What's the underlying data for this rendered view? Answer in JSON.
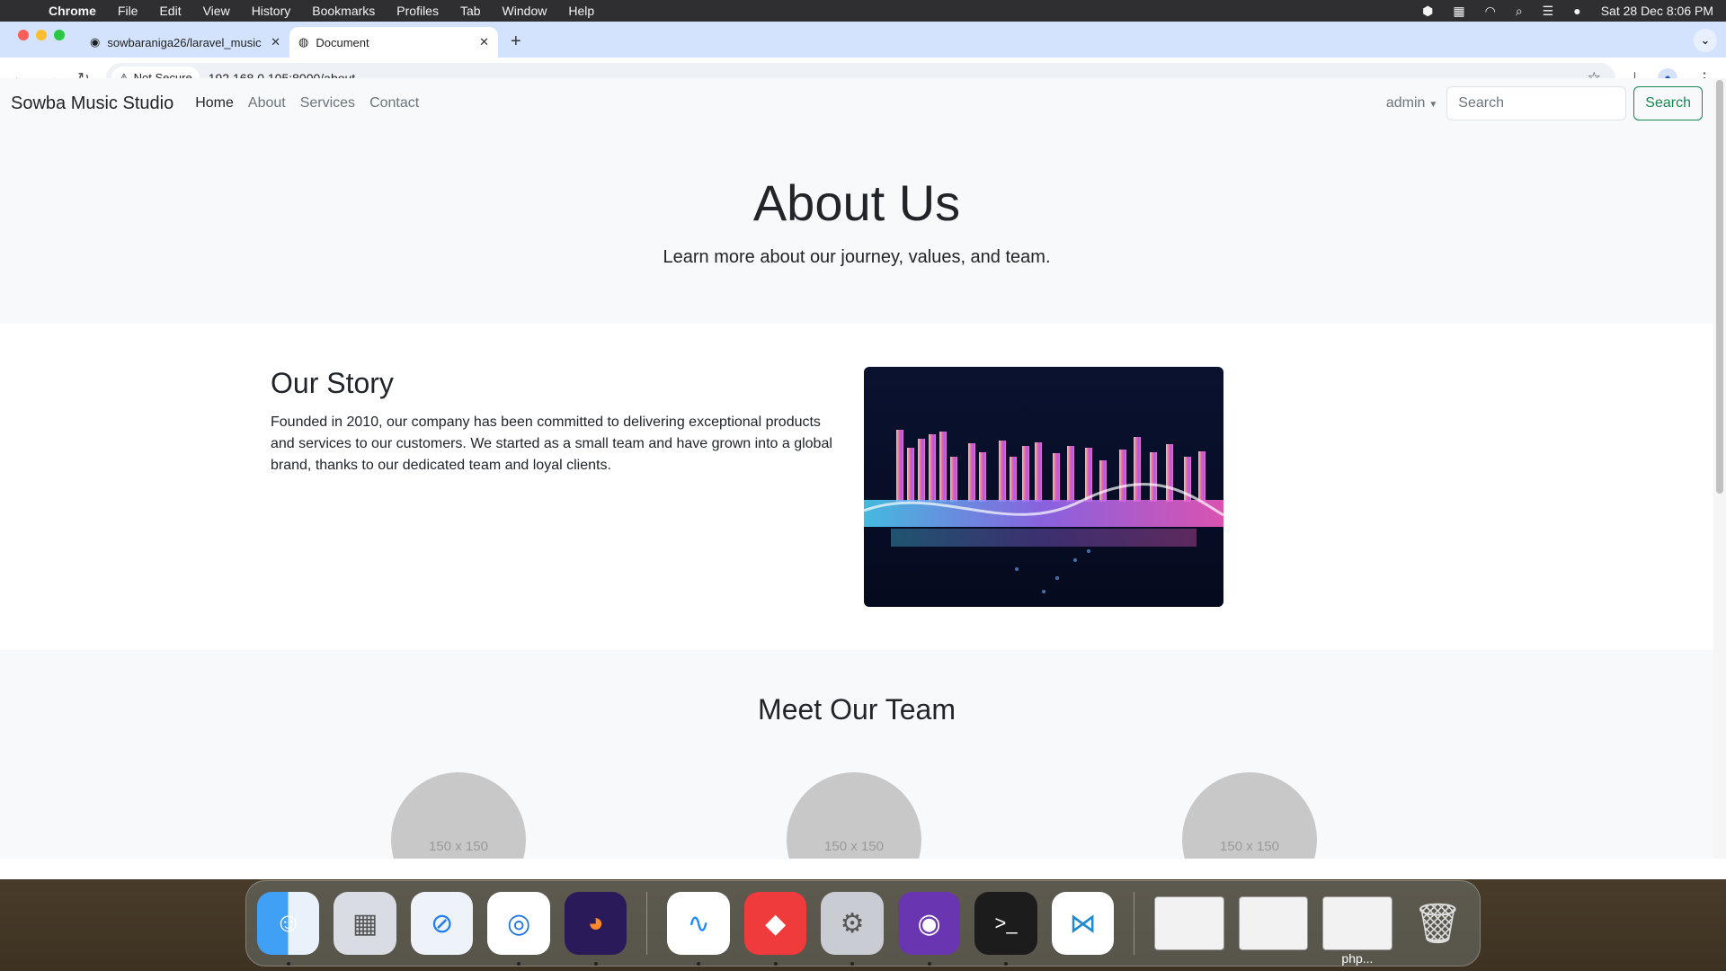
{
  "menubar": {
    "app": "Chrome",
    "items": [
      "File",
      "Edit",
      "View",
      "History",
      "Bookmarks",
      "Profiles",
      "Tab",
      "Window",
      "Help"
    ],
    "datetime": "Sat 28 Dec  8:06 PM"
  },
  "browser": {
    "tabs": [
      {
        "title": "sowbaraniga26/laravel_music"
      },
      {
        "title": "Document"
      }
    ],
    "security_label": "Not Secure",
    "url": "192.168.0.105:8000/about"
  },
  "site": {
    "brand": "Sowba Music Studio",
    "nav": [
      "Home",
      "About",
      "Services",
      "Contact"
    ],
    "user": "admin",
    "search_placeholder": "Search",
    "search_button": "Search"
  },
  "hero": {
    "title": "About Us",
    "subtitle": "Learn more about our journey, values, and team."
  },
  "story": {
    "heading": "Our Story",
    "text": "Founded in 2010, our company has been committed to delivering exceptional products and services to our customers. We started as a small team and have grown into a global brand, thanks to our dedicated team and loyal clients."
  },
  "team": {
    "heading": "Meet Our Team",
    "placeholders": [
      "150 x 150",
      "150 x 150",
      "150 x 150"
    ]
  },
  "dock": {
    "thumb_label": "php..."
  }
}
